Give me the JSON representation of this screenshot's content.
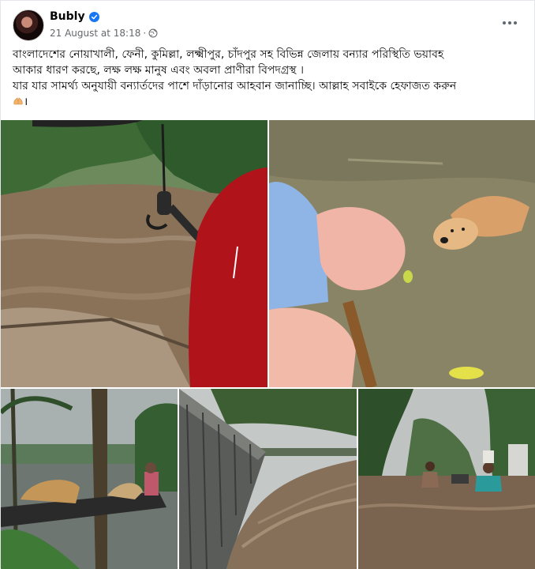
{
  "post": {
    "author": "Bubly",
    "timestamp": "21 August at 18:18",
    "separator": "·",
    "text_line1": "বাংলাদেশের নোয়াখালী, ফেনী, কুমিল্লা, লক্ষ্মীপুর, চাঁদপুর সহ বিভিন্ন জেলায় বন্যার পরিস্থিতি ভয়াবহ",
    "text_line2": "আকার ধারণ করছে, লক্ষ লক্ষ মানুষ এবং অবলা প্রাণীরা বিপদগ্রস্থ ।",
    "text_line3": "যার যার সামর্থ্য অনুযায়ী বন্যার্তদের পাশে দাঁড়ানোর আহবান জানাচ্ছি। আল্লাহ সবাইকে হেফাজত করুন",
    "text_line4_suffix": "।",
    "icons": {
      "verified": "verified-badge-icon",
      "audience": "globe-icon",
      "menu": "more-options-icon",
      "emoji": "praying-hands-emoji"
    },
    "colors": {
      "verified_blue": "#1877f2",
      "meta_gray": "#65676b",
      "floodwater": "#8a6f55"
    }
  }
}
